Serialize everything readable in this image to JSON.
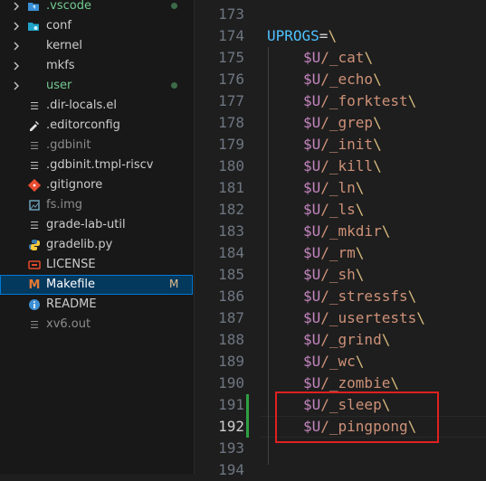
{
  "explorer": {
    "items": [
      {
        "label": ".vscode",
        "kind": "folder",
        "color": "#73c991",
        "status": "dot"
      },
      {
        "label": "conf",
        "kind": "folder",
        "color": "#cccccc",
        "status": ""
      },
      {
        "label": "kernel",
        "kind": "folder",
        "color": "#cccccc",
        "status": ""
      },
      {
        "label": "mkfs",
        "kind": "folder",
        "color": "#cccccc",
        "status": ""
      },
      {
        "label": "user",
        "kind": "folder",
        "color": "#73c991",
        "status": "dot"
      },
      {
        "label": ".dir-locals.el",
        "kind": "file",
        "color": "#cccccc",
        "status": ""
      },
      {
        "label": ".editorconfig",
        "kind": "file",
        "color": "#cccccc",
        "status": ""
      },
      {
        "label": ".gdbinit",
        "kind": "file",
        "color": "#8c8c8c",
        "status": ""
      },
      {
        "label": ".gdbinit.tmpl-riscv",
        "kind": "file",
        "color": "#cccccc",
        "status": ""
      },
      {
        "label": ".gitignore",
        "kind": "file",
        "color": "#cccccc",
        "status": ""
      },
      {
        "label": "fs.img",
        "kind": "file",
        "color": "#8c8c8c",
        "status": ""
      },
      {
        "label": "grade-lab-util",
        "kind": "file",
        "color": "#cccccc",
        "status": ""
      },
      {
        "label": "gradelib.py",
        "kind": "file",
        "color": "#cccccc",
        "status": ""
      },
      {
        "label": "LICENSE",
        "kind": "file",
        "color": "#cccccc",
        "status": ""
      },
      {
        "label": "Makefile",
        "kind": "file",
        "color": "#ffffff",
        "status": "M"
      },
      {
        "label": "README",
        "kind": "file",
        "color": "#cccccc",
        "status": ""
      },
      {
        "label": "xv6.out",
        "kind": "file",
        "color": "#8c8c8c",
        "status": ""
      }
    ]
  },
  "editor": {
    "lines": [
      {
        "num": "173",
        "text": ""
      },
      {
        "num": "174",
        "text": "UPROGS=\\"
      },
      {
        "num": "175",
        "text": "$U/_cat\\"
      },
      {
        "num": "176",
        "text": "$U/_echo\\"
      },
      {
        "num": "177",
        "text": "$U/_forktest\\"
      },
      {
        "num": "178",
        "text": "$U/_grep\\"
      },
      {
        "num": "179",
        "text": "$U/_init\\"
      },
      {
        "num": "180",
        "text": "$U/_kill\\"
      },
      {
        "num": "181",
        "text": "$U/_ln\\"
      },
      {
        "num": "182",
        "text": "$U/_ls\\"
      },
      {
        "num": "183",
        "text": "$U/_mkdir\\"
      },
      {
        "num": "184",
        "text": "$U/_rm\\"
      },
      {
        "num": "185",
        "text": "$U/_sh\\"
      },
      {
        "num": "186",
        "text": "$U/_stressfs\\"
      },
      {
        "num": "187",
        "text": "$U/_usertests\\"
      },
      {
        "num": "188",
        "text": "$U/_grind\\"
      },
      {
        "num": "189",
        "text": "$U/_wc\\"
      },
      {
        "num": "190",
        "text": "$U/_zombie\\"
      },
      {
        "num": "191",
        "text": "$U/_sleep\\"
      },
      {
        "num": "192",
        "text": "$U/_pingpong\\"
      },
      {
        "num": "193",
        "text": ""
      },
      {
        "num": "194",
        "text": ""
      }
    ],
    "active_line": "192",
    "added_lines": [
      "191",
      "192"
    ]
  },
  "colors": {
    "variable": "#c586c0",
    "path_text": "#ce9178",
    "keyword": "#4fc1ff",
    "git_added": "#2ea043",
    "highlight_box": "#e02020"
  }
}
